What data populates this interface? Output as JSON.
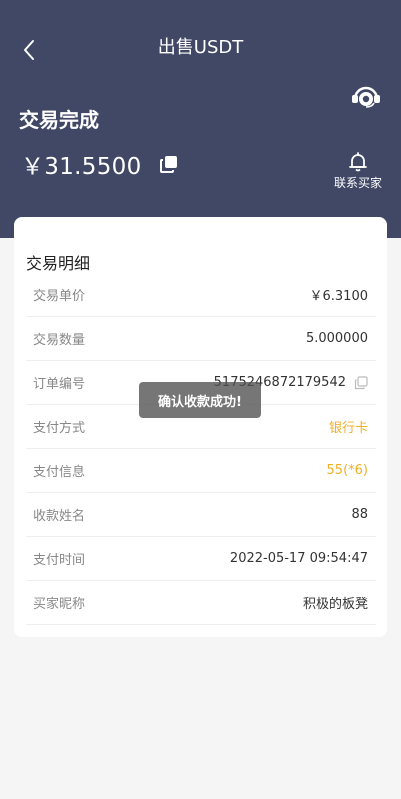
{
  "nav": {
    "title": "出售USDT"
  },
  "status": {
    "title": "交易完成",
    "amount": "￥31.5500",
    "contact_label": "联系买家"
  },
  "details": {
    "title": "交易明细",
    "rows": [
      {
        "label": "交易单价",
        "value": "￥6.3100"
      },
      {
        "label": "交易数量",
        "value": "5.000000"
      },
      {
        "label": "订单编号",
        "value": "5175246872179542"
      },
      {
        "label": "支付方式",
        "value": "银行卡"
      },
      {
        "label": "支付信息",
        "value": "55(*6)"
      },
      {
        "label": "收款姓名",
        "value": "88"
      },
      {
        "label": "支付时间",
        "value": "2022-05-17 09:54:47"
      },
      {
        "label": "买家昵称",
        "value": "积极的板凳"
      }
    ]
  },
  "toast": {
    "text": "确认收款成功!"
  },
  "colors": {
    "header_bg": "#414866",
    "accent": "#f0b026"
  }
}
